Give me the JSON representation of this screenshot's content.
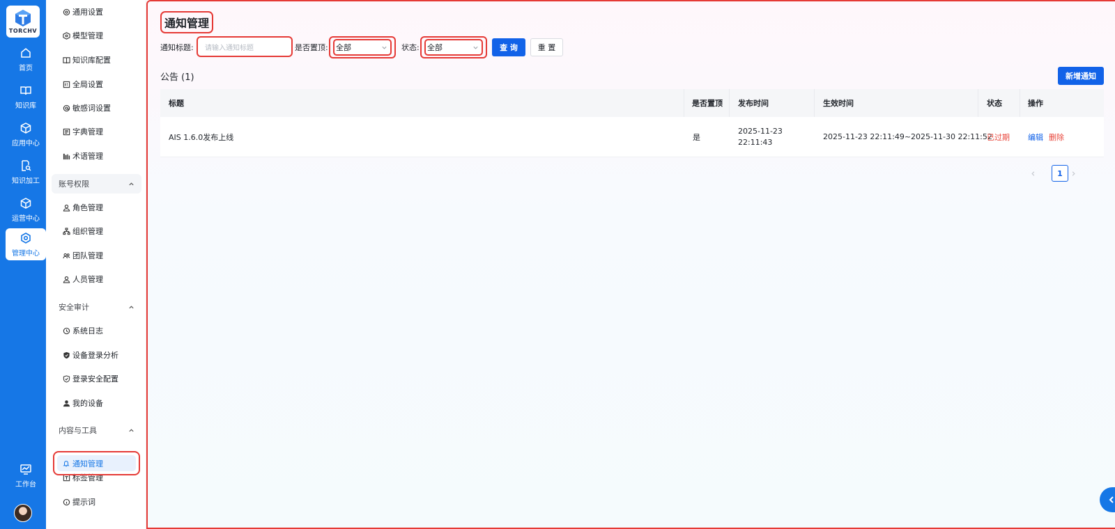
{
  "app": {
    "logo_text": "TORCHV"
  },
  "rail": {
    "items": [
      {
        "label": "首页",
        "icon": "home-icon"
      },
      {
        "label": "知识库",
        "icon": "book-icon"
      },
      {
        "label": "应用中心",
        "icon": "cube-icon"
      },
      {
        "label": "知识加工",
        "icon": "doc-search-icon"
      },
      {
        "label": "运营中心",
        "icon": "cube-icon"
      },
      {
        "label": "管理中心",
        "icon": "gear-hex-icon",
        "active": true
      }
    ],
    "workbench": {
      "label": "工作台",
      "icon": "monitor-chart-icon"
    }
  },
  "sidebar": {
    "items_top": [
      {
        "label": "通用设置",
        "icon": "gear-icon"
      },
      {
        "label": "模型管理",
        "icon": "model-icon"
      },
      {
        "label": "知识库配置",
        "icon": "book-icon"
      },
      {
        "label": "全局设置",
        "icon": "panel-icon"
      },
      {
        "label": "敏感词设置",
        "icon": "at-icon"
      },
      {
        "label": "字典管理",
        "icon": "list-icon"
      },
      {
        "label": "术语管理",
        "icon": "bars-icon"
      }
    ],
    "group_account": {
      "label": "账号权限"
    },
    "items_account": [
      {
        "label": "角色管理",
        "icon": "user-icon"
      },
      {
        "label": "组织管理",
        "icon": "org-icon"
      },
      {
        "label": "团队管理",
        "icon": "team-icon"
      },
      {
        "label": "人员管理",
        "icon": "user-icon"
      }
    ],
    "group_security": {
      "label": "安全审计"
    },
    "items_security": [
      {
        "label": "系统日志",
        "icon": "clock-icon"
      },
      {
        "label": "设备登录分析",
        "icon": "shield-check-icon"
      },
      {
        "label": "登录安全配置",
        "icon": "shield-icon"
      },
      {
        "label": "我的设备",
        "icon": "person-icon"
      }
    ],
    "group_content": {
      "label": "内容与工具"
    },
    "items_content": [
      {
        "label": "通知管理",
        "icon": "bell-icon",
        "active": true
      },
      {
        "label": "标签管理",
        "icon": "tag-icon"
      },
      {
        "label": "提示词",
        "icon": "info-icon"
      }
    ]
  },
  "page": {
    "title": "通知管理",
    "filters": {
      "title_label": "通知标题:",
      "title_placeholder": "请输入通知标题",
      "top_label": "是否置顶:",
      "top_value": "全部",
      "status_label": "状态:",
      "status_value": "全部",
      "query_button": "查 询",
      "reset_button": "重 置"
    },
    "section_title": "公告 (1)",
    "new_button": "新增通知",
    "table": {
      "headers": {
        "title": "标题",
        "is_top": "是否置顶",
        "publish_time": "发布时间",
        "effective_time": "生效时间",
        "status": "状态",
        "actions": "操作"
      },
      "rows": [
        {
          "title": "AIS 1.6.0发布上线",
          "is_top": "是",
          "publish_date": "2025-11-23",
          "publish_clock": "22:11:43",
          "effective_time": "2025-11-23 22:11:49~2025-11-30 22:11:52",
          "status": "已过期",
          "edit": "编辑",
          "delete": "删除"
        }
      ]
    },
    "pagination": {
      "current": "1"
    }
  },
  "colors": {
    "brand": "#1677e6",
    "primary": "#1262e8",
    "danger": "#e8463b",
    "highlight": "#e53935"
  }
}
